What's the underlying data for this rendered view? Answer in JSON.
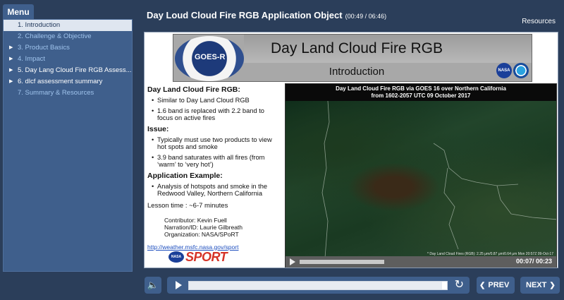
{
  "menu": {
    "tab_label": "Menu",
    "items": [
      {
        "label": "1. Introduction",
        "state": "active",
        "arrow": ""
      },
      {
        "label": "2. Challenge & Objective",
        "state": "unvisited",
        "arrow": ""
      },
      {
        "label": "3. Product Basics",
        "state": "unvisited",
        "arrow": "▶"
      },
      {
        "label": "4. Impact",
        "state": "unvisited",
        "arrow": "▶"
      },
      {
        "label": "5. Day Lang Cloud Fire RGB Assess...",
        "state": "visited",
        "arrow": "▶"
      },
      {
        "label": "6. dlcf assessment summary",
        "state": "visited",
        "arrow": "▶"
      },
      {
        "label": "7. Summary & Resources",
        "state": "unvisited",
        "arrow": ""
      }
    ]
  },
  "header": {
    "title": "Day Loud Cloud Fire RGB Application Object",
    "duration": "(00:49 / 06:46)",
    "resources": "Resources"
  },
  "slide": {
    "banner_title": "Day Land Cloud Fire RGB",
    "banner_subtitle": "Introduction",
    "goes_logo_text": "GOES-R",
    "nasa_logo_text": "NASA",
    "heading1": "Day Land Cloud Fire RGB:",
    "bullets1": [
      "Similar to Day Land Cloud RGB",
      "1.6 band is replaced with 2.2 band to focus on active fires"
    ],
    "heading2": "Issue:",
    "bullets2": [
      "Typically must use two products to view hot spots and smoke",
      "3.9 band saturates with all fires (from ‘warm’ to ‘very hot’)"
    ],
    "heading3": "Application Example:",
    "bullets3": [
      "Analysis of hotspots and smoke in the Redwood Valley, Northern California"
    ],
    "lesson_time": "Lesson time : ~6-7 minutes",
    "contributor": "Contributor: Kevin Fuell",
    "narration": "Narration/ID: Laurie Gilbreath",
    "organization": "Organization: NASA/SPoRT",
    "link": "http://weather.msfc.nasa.gov/sport",
    "sport_logo_nasa": "NASA",
    "sport_logo_text": "SPORT"
  },
  "video": {
    "title_line1": "Day Land Cloud Fire RGB via GOES 16 over Northern California",
    "title_line2": "from 1602-2057 UTC 09 October 2017",
    "caption": "* Day Land Cloud Fires (RGB): 2.25 μm/0.87 μm/0.64 μm Mon 20:57Z 09-Oct-17",
    "time": "00:07/ 00:23",
    "progress": 0.3
  },
  "controls": {
    "prev_label": "PREV",
    "next_label": "NEXT",
    "progress": 0.98
  },
  "colors": {
    "background": "#2b3e5a",
    "panel": "#3f5f8c",
    "active_item": "#dfe6f0",
    "unvisited_text": "#9fc3ec",
    "sport_red": "#d63327"
  }
}
